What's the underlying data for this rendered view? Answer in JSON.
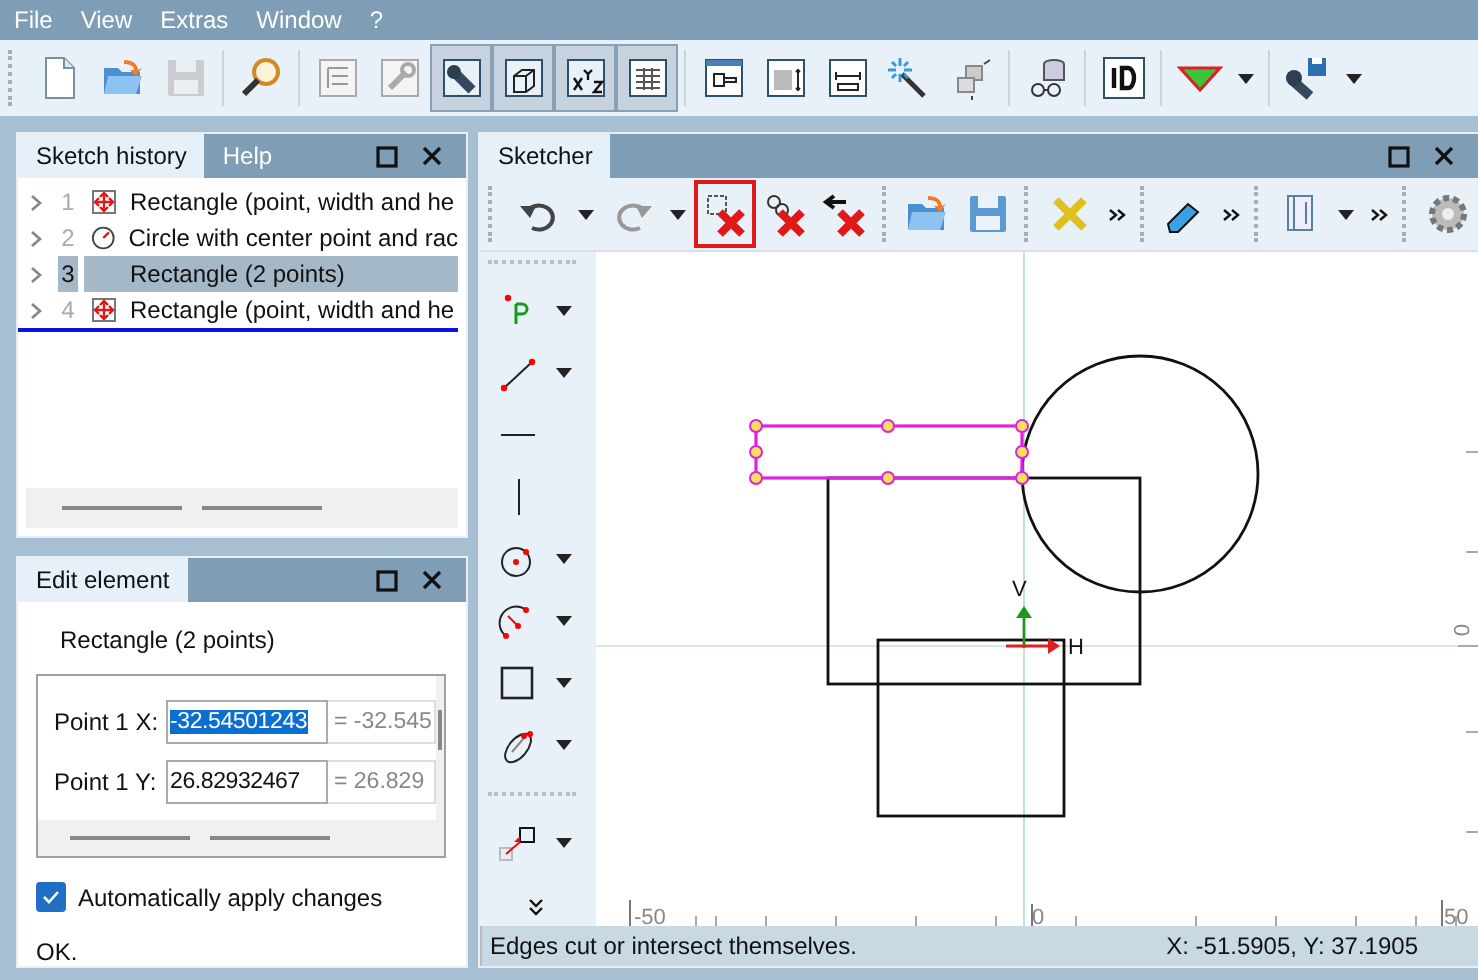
{
  "menu": [
    "File",
    "View",
    "Extras",
    "Window",
    "?"
  ],
  "toolbar": {
    "buttons": [
      {
        "pressed": false
      },
      {
        "pressed": false
      },
      {
        "pressed": false
      },
      {
        "pressed": false
      },
      {
        "pressed": false
      },
      {
        "pressed": false
      },
      {
        "pressed": true
      },
      {
        "pressed": true
      },
      {
        "pressed": true
      },
      {
        "pressed": true
      },
      {
        "pressed": false
      },
      {
        "pressed": false
      },
      {
        "pressed": false
      },
      {
        "pressed": false
      },
      {
        "pressed": false
      },
      {
        "pressed": false
      },
      {
        "pressed": false
      },
      {
        "pressed": false
      },
      {
        "pressed": false
      }
    ]
  },
  "left_panel": {
    "tabs": [
      {
        "label": "Sketch history",
        "selected": true
      },
      {
        "label": "Help",
        "selected": false
      }
    ],
    "history": [
      {
        "number": "1",
        "kind": "rectangle",
        "label": "Rectangle (point, width and he",
        "selected": false,
        "current": false
      },
      {
        "number": "2",
        "kind": "circle",
        "label": "Circle with center point and rac",
        "selected": false,
        "current": false
      },
      {
        "number": "3",
        "kind": "none",
        "label": "Rectangle (2 points)",
        "selected": true,
        "current": false
      },
      {
        "number": "4",
        "kind": "rectangle",
        "label": "Rectangle (point, width and he",
        "selected": false,
        "current": true
      }
    ]
  },
  "edit_panel": {
    "tabs": [
      {
        "label": "Edit element",
        "selected": true
      }
    ],
    "element": "Rectangle (2 points)",
    "fields": [
      {
        "label": "Point 1 X:",
        "value": "-32.54501243",
        "result": "= -32.545",
        "selected": true
      },
      {
        "label": "Point 1 Y:",
        "value": "26.82932467",
        "result": "= 26.829",
        "selected": false
      }
    ],
    "auto_apply": {
      "label": "Automatically apply changes",
      "checked": true
    },
    "message": "OK."
  },
  "sketcher": {
    "tabs": [
      {
        "label": "Sketcher",
        "selected": true
      }
    ],
    "ruler": {
      "x_labels": [
        "-50",
        "0",
        "50"
      ],
      "y_labels": [
        "0"
      ]
    },
    "axes": {
      "vertical": "V",
      "horizontal": "H"
    },
    "status": {
      "message": "Edges cut or intersect themselves.",
      "coordinates": "X: -51.5905, Y: 37.1905"
    }
  }
}
